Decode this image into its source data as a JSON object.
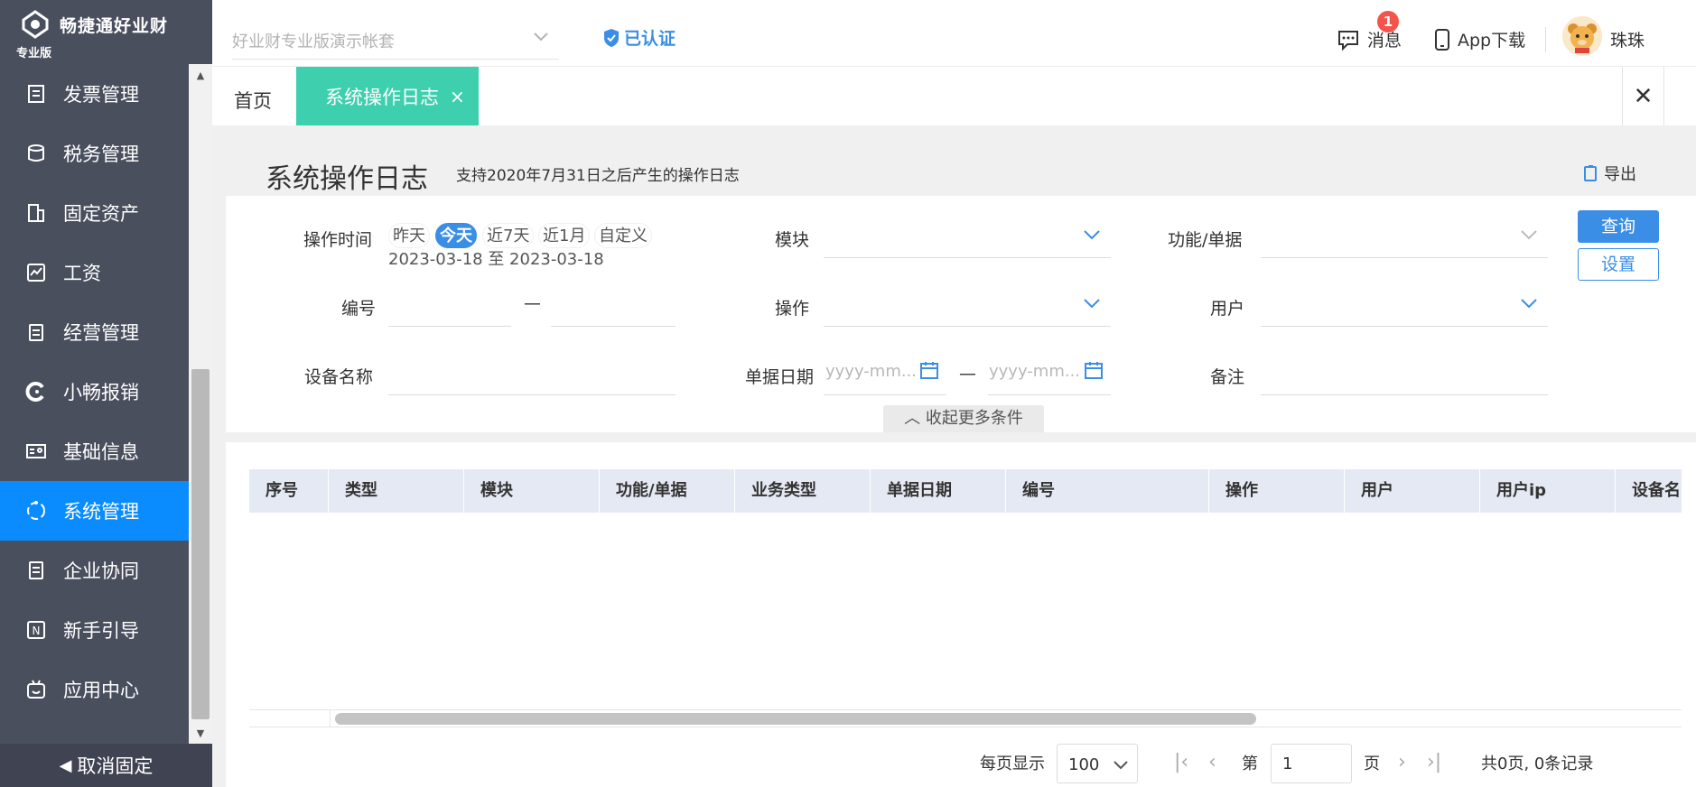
{
  "app": {
    "brand": "畅捷通好业财",
    "edition": "专业版"
  },
  "sidebar": {
    "items": [
      {
        "label": "发票管理",
        "icon": "invoice-icon"
      },
      {
        "label": "税务管理",
        "icon": "tax-icon"
      },
      {
        "label": "固定资产",
        "icon": "building-icon"
      },
      {
        "label": "工资",
        "icon": "salary-icon"
      },
      {
        "label": "经营管理",
        "icon": "clipboard-icon"
      },
      {
        "label": "小畅报销",
        "icon": "reimburse-icon"
      },
      {
        "label": "基础信息",
        "icon": "id-card-icon"
      },
      {
        "label": "系统管理",
        "icon": "system-icon",
        "active": true
      },
      {
        "label": "企业协同",
        "icon": "collab-icon"
      },
      {
        "label": "新手引导",
        "icon": "new-icon"
      },
      {
        "label": "应用中心",
        "icon": "app-center-icon"
      }
    ],
    "unpin_label": "取消固定"
  },
  "topbar": {
    "account_placeholder": "好业财专业版演示帐套",
    "verified_label": "已认证",
    "messages_label": "消息",
    "messages_badge": "1",
    "app_download_label": "App下载",
    "username": "珠珠"
  },
  "tabs": {
    "home_label": "首页",
    "active_label": "系统操作日志",
    "active_close": "×",
    "close_all": "✕"
  },
  "page": {
    "title": "系统操作日志",
    "subtitle": "支持2020年7月31日之后产生的操作日志",
    "export_label": "导出"
  },
  "filters": {
    "op_time_label": "操作时间",
    "quick_ranges": [
      "昨天",
      "今天",
      "近7天",
      "近1月",
      "自定义"
    ],
    "selected_range": "今天",
    "date_range_text": "2023-03-18 至 2023-03-18",
    "module_label": "模块",
    "function_label": "功能/单据",
    "number_label": "编号",
    "number_dash": "—",
    "operation_label": "操作",
    "user_label": "用户",
    "device_label": "设备名称",
    "doc_date_label": "单据日期",
    "doc_date_start_placeholder": "yyyy-mm...",
    "doc_date_end_placeholder": "yyyy-mm...",
    "doc_date_dash": "—",
    "remark_label": "备注",
    "query_label": "查询",
    "settings_label": "设置",
    "collapse_label": "收起更多条件"
  },
  "table": {
    "columns": [
      "序号",
      "类型",
      "模块",
      "功能/单据",
      "业务类型",
      "单据日期",
      "编号",
      "操作",
      "用户",
      "用户ip",
      "设备名"
    ],
    "rows": []
  },
  "pagination": {
    "per_page_label": "每页显示",
    "per_page_value": "100",
    "page_prefix": "第",
    "page_value": "1",
    "page_suffix": "页",
    "summary": "共0页, 0条记录"
  },
  "colors": {
    "sidebar_bg": "#4a4f5e",
    "active_menu": "#0a8cff",
    "tab_active": "#3ecfae",
    "primary": "#3a8ee6",
    "badge": "#f5544a"
  }
}
